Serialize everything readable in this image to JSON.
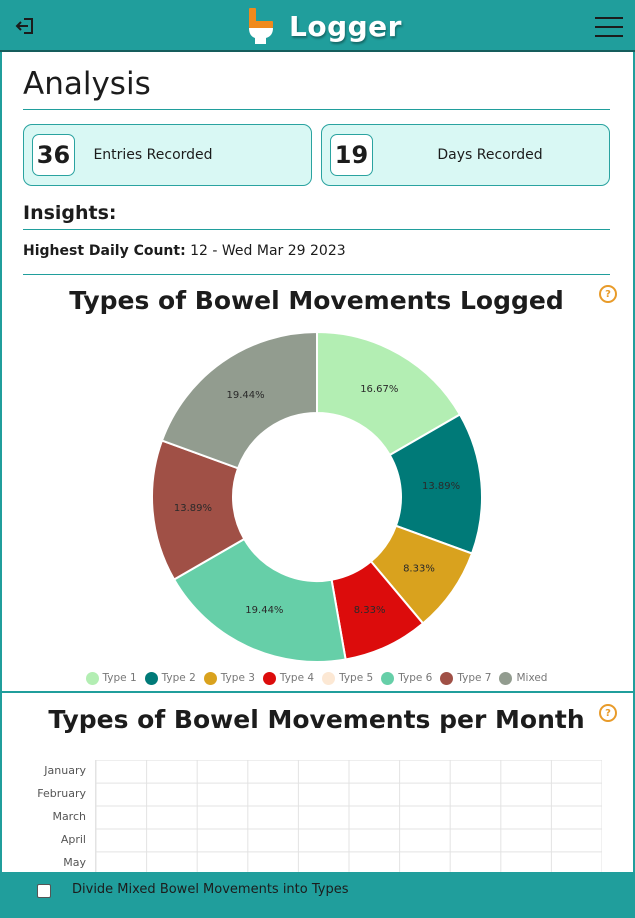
{
  "header": {
    "app_name": "Logger",
    "icons": {
      "logout": "logout-icon",
      "logo": "toilet-logo",
      "menu": "hamburger-menu-icon"
    },
    "color": "#209e9c"
  },
  "page": {
    "title": "Analysis"
  },
  "stats": {
    "entries": {
      "value": "36",
      "label": "Entries Recorded"
    },
    "days": {
      "value": "19",
      "label": "Days Recorded"
    }
  },
  "insights": {
    "heading": "Insights:",
    "highest_label": "Highest Daily Count:",
    "highest_value": " 12 - Wed Mar 29 2023"
  },
  "charts": [
    {
      "title": "Types of Bowel Movements Logged",
      "help_icon": "?"
    },
    {
      "title": "Types of Bowel Movements per Month",
      "help_icon": "?"
    }
  ],
  "chart_data": [
    {
      "type": "pie",
      "title": "Types of Bowel Movements Logged",
      "donut": true,
      "legend_position": "bottom",
      "categories": [
        "Type 1",
        "Type 2",
        "Type 3",
        "Type 4",
        "Type 5",
        "Type 6",
        "Type 7",
        "Mixed"
      ],
      "values": [
        16.67,
        13.89,
        8.33,
        8.33,
        0,
        19.44,
        13.89,
        19.44
      ],
      "labels": [
        "16.67%",
        "13.89%",
        "8.33%",
        "8.33%",
        "",
        "19.44%",
        "13.89%",
        "19.44%"
      ],
      "colors": [
        "#b3eeb3",
        "#007a78",
        "#d9a21e",
        "#dc0c0c",
        "#fce8d4",
        "#66cfa8",
        "#a05046",
        "#929c8f"
      ]
    },
    {
      "type": "bar",
      "title": "Types of Bowel Movements per Month",
      "categories": [
        "January",
        "February",
        "March",
        "April",
        "May"
      ],
      "grid": true,
      "series": []
    }
  ],
  "footer": {
    "checkbox_label": "Divide Mixed Bowel Movements into Types",
    "checked": false
  }
}
